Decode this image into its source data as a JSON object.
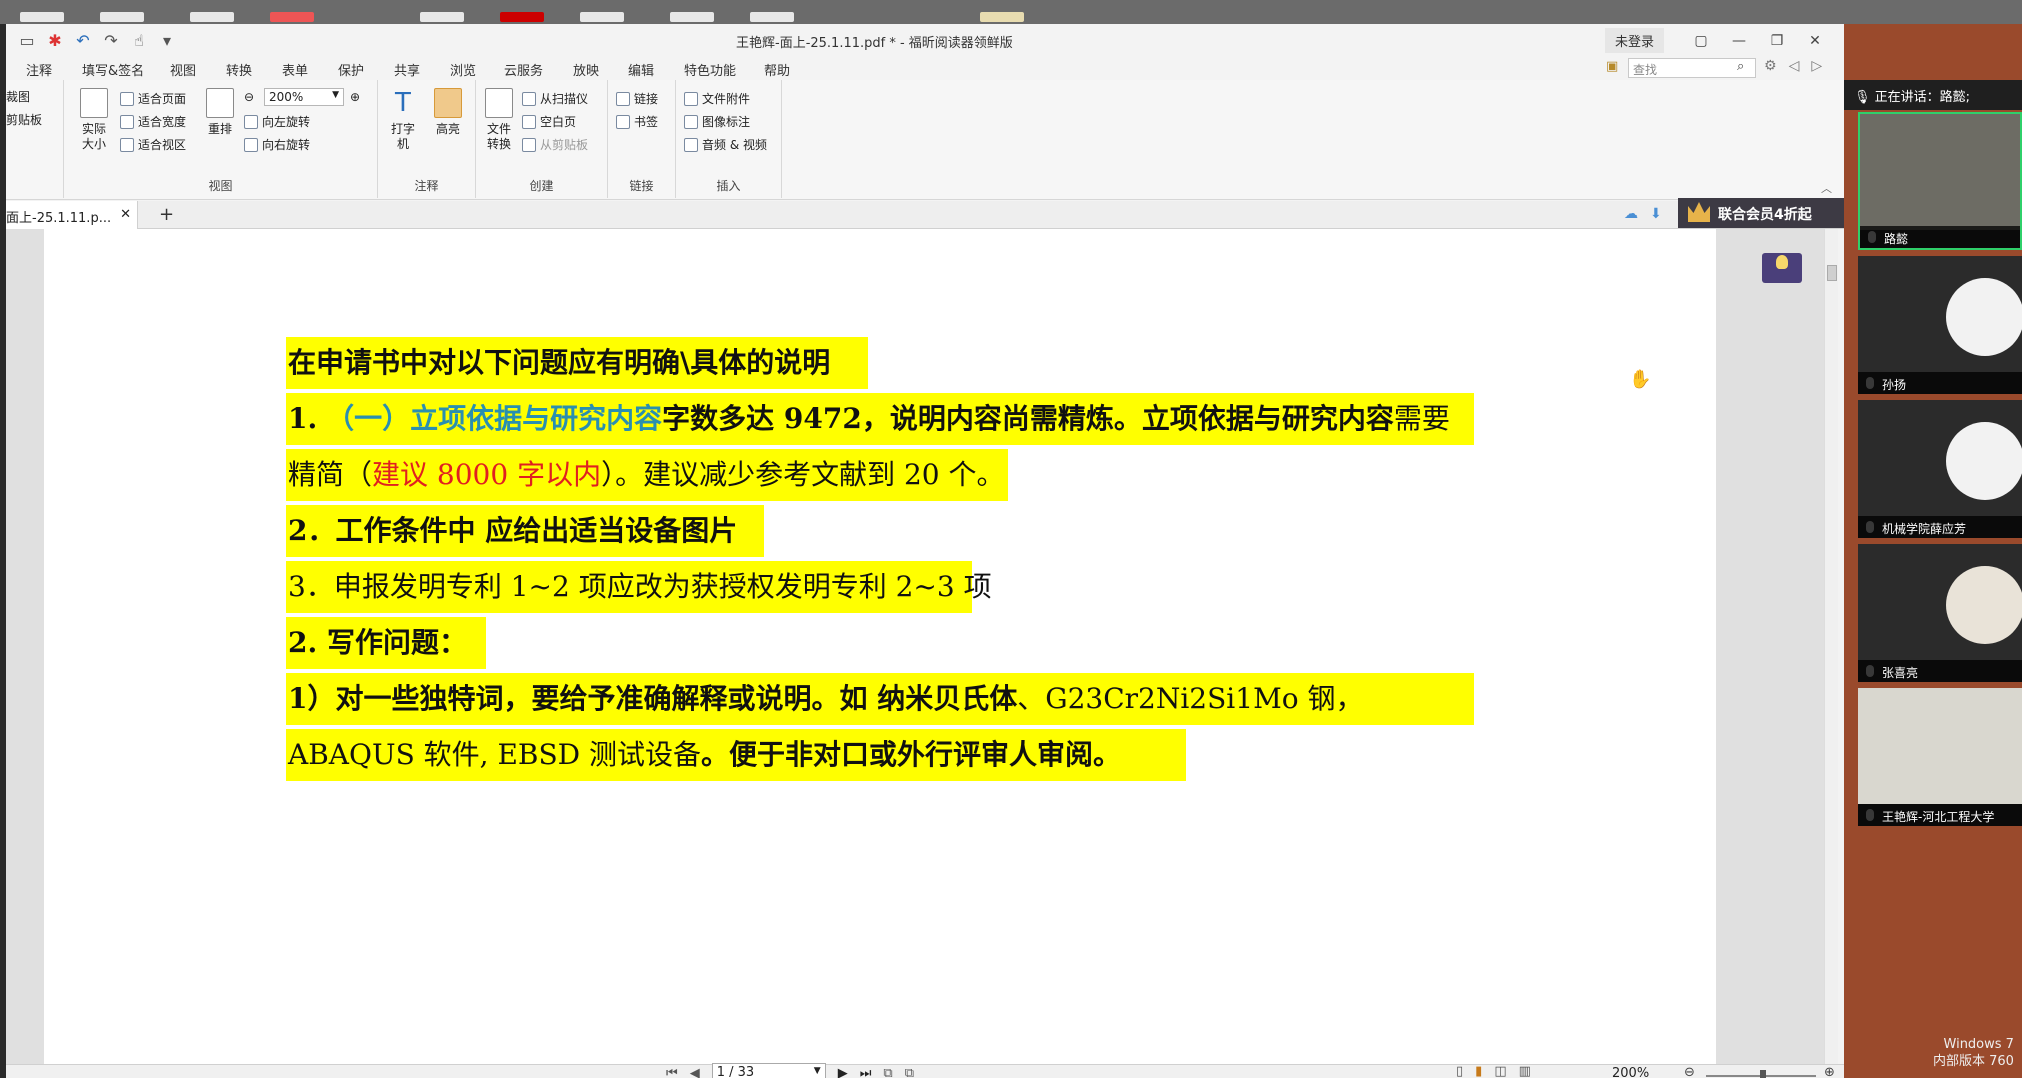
{
  "window": {
    "title": "王艳辉-面上-25.1.11.pdf * - 福昕阅读器领鲜版",
    "login_label": "未登录",
    "controls": [
      "▢",
      "—",
      "❐",
      "✕"
    ]
  },
  "menu": [
    "注释",
    "填写&签名",
    "视图",
    "转换",
    "表单",
    "保护",
    "共享",
    "浏览",
    "云服务",
    "放映",
    "编辑",
    "特色功能",
    "帮助"
  ],
  "search": {
    "placeholder": "查找"
  },
  "ribbon": {
    "partial_left": [
      "裁图",
      "剪贴板"
    ],
    "view": {
      "label": "视图",
      "actual_size": "实际大小",
      "fit_page": "适合页面",
      "fit_width": "适合宽度",
      "fit_visible": "适合视区",
      "reflow": "重排",
      "zoom": "200%",
      "rotate_left": "向左旋转",
      "rotate_right": "向右旋转"
    },
    "annotate": {
      "label": "注释",
      "typewriter": "打字机",
      "highlight": "高亮"
    },
    "create": {
      "label": "创建",
      "file_convert": "文件转换",
      "from_scanner": "从扫描仪",
      "blank_page": "空白页",
      "from_clipboard": "从剪贴板"
    },
    "links": {
      "label": "链接",
      "link": "链接",
      "bookmark": "书签"
    },
    "insert": {
      "label": "插入",
      "file_attachment": "文件附件",
      "image_annotation": "图像标注",
      "audio_video": "音频 & 视频"
    }
  },
  "tabs": {
    "doc_tab": "面上-25.1.11.p...",
    "add": "+",
    "promo": "联合会员4折起"
  },
  "document": {
    "line1": "在申请书中对以下问题应有明确\\具体的说明",
    "line2": {
      "num": "1.",
      "blue": "（一）立项依据与研究内容",
      "bold": "字数多达 9472，说明内容尚需精炼。立项依据与研究内容",
      "normal": "需要"
    },
    "line3": {
      "a": "精简（",
      "red": "建议 8000 字以内",
      "b": "）。建议减少参考文献到 20 个。"
    },
    "line4": "2．工作条件中  应给出适当设备图片",
    "line5": "3．申报发明专利 1~2 项应改为获授权发明专利 2~3 项",
    "line6": "2. 写作问题：",
    "line7": {
      "bold": "1）对一些独特词，要给予准确解释或说明。如  纳米贝氏体",
      "normal": "、G23Cr2Ni2Si1Mo  钢，"
    },
    "line8": {
      "normal": "ABAQUS 软件, EBSD 测试设备",
      "bold": "。便于非对口或外行评审人审阅。"
    }
  },
  "status": {
    "page": "1 / 33",
    "zoom": "200%"
  },
  "meeting": {
    "speaking_label": "正在讲话：路懿;",
    "participants": [
      {
        "name": "路懿",
        "type": "camera",
        "active": true
      },
      {
        "name": "孙扬",
        "type": "avatar"
      },
      {
        "name": "机械学院薛应芳",
        "type": "avatar"
      },
      {
        "name": "张喜亮",
        "type": "avatar"
      },
      {
        "name": "王艳辉-河北工程大学",
        "type": "camera"
      }
    ]
  },
  "os": {
    "windows_line1": "Windows 7",
    "windows_line2": "内部版本 760"
  }
}
